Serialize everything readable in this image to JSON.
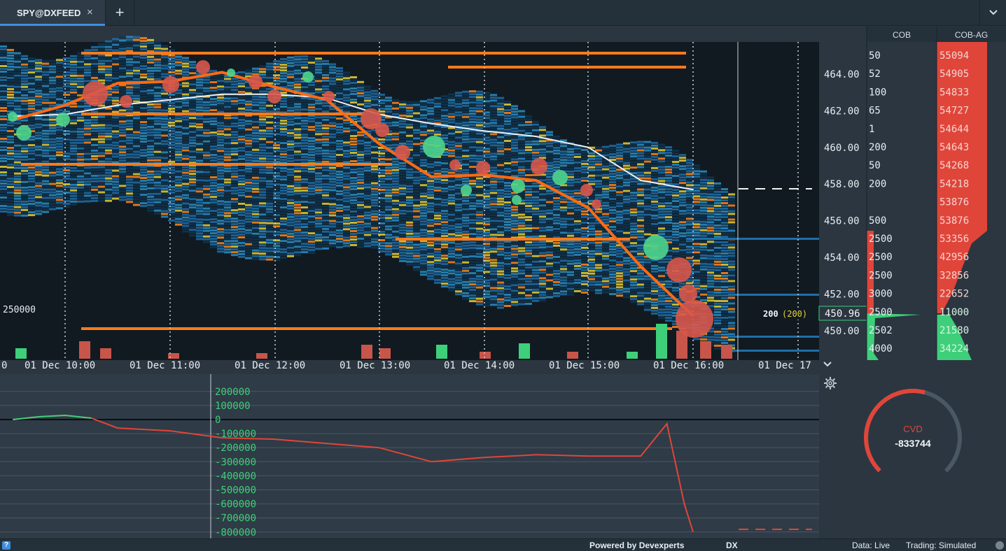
{
  "tab": {
    "title": "SPY@DXFEED",
    "close": "×",
    "add": "+",
    "menu": "⌄"
  },
  "price_axis": {
    "labels": [
      "464.00",
      "462.00",
      "460.00",
      "458.00",
      "456.00",
      "454.00",
      "452.00",
      "450.00"
    ],
    "current": "450.96"
  },
  "time_axis": {
    "labels": [
      "0",
      "01 Dec 10:00",
      "01 Dec 11:00",
      "01 Dec 12:00",
      "01 Dec 13:00",
      "01 Dec 14:00",
      "01 Dec 15:00",
      "01 Dec 16:00",
      "01 Dec 17"
    ]
  },
  "volume_scale_label": "250000",
  "order_label": {
    "size": "200",
    "paren": "(200)"
  },
  "cob": {
    "header": "COB",
    "values": [
      "50",
      "52",
      "100",
      "65",
      "1",
      "200",
      "50",
      "200",
      "",
      "500",
      "2500",
      "2500",
      "2500",
      "3000",
      "2500",
      "2502",
      "4000"
    ]
  },
  "cob_ag": {
    "header": "COB-AG",
    "values": [
      "55094",
      "54905",
      "54833",
      "54727",
      "54644",
      "54643",
      "54268",
      "54218",
      "53876",
      "53876",
      "53356",
      "42956",
      "32856",
      "22652",
      "11000",
      "21580",
      "34224"
    ]
  },
  "cvd_axis": {
    "labels": [
      "200000",
      "100000",
      "0",
      "-100000",
      "-200000",
      "-300000",
      "-400000",
      "-500000",
      "-600000",
      "-700000",
      "-800000"
    ]
  },
  "cvd": {
    "label": "CVD",
    "value": "-833744"
  },
  "status": {
    "powered": "Powered by Devexperts",
    "dx": "DX",
    "data": "Data: Live",
    "trading": "Trading: Simulated",
    "help": "?"
  },
  "colors": {
    "background": "#1a232b",
    "ask": "#e0453a",
    "bid": "#3ecf7a",
    "level": "#ff7a1a",
    "accent": "#3d8fe0"
  },
  "chart_data": [
    {
      "type": "line",
      "title": "",
      "ylabel": "",
      "ylim": [
        449,
        465
      ],
      "x": [
        "09:30",
        "10:00",
        "10:30",
        "11:00",
        "11:30",
        "12:00",
        "12:30",
        "13:00",
        "13:30",
        "14:00",
        "14:30",
        "15:00",
        "15:30",
        "16:00"
      ],
      "series": [
        {
          "values": [
            461.7,
            461.8,
            462.3,
            462.6,
            462.9,
            462.9,
            462.7,
            461.8,
            461.3,
            460.9,
            460.6,
            460.0,
            458.2,
            457.7
          ]
        },
        {
          "values": [
            461.5,
            462.3,
            463.5,
            463.6,
            464.1,
            463.3,
            462.6,
            460.2,
            458.4,
            458.5,
            458.2,
            456.7,
            453.5,
            450.8
          ]
        }
      ]
    },
    {
      "type": "line",
      "title": "",
      "ylabel": "",
      "ylim": [
        -850000,
        250000
      ],
      "x": [
        "09:30",
        "09:45",
        "10:00",
        "10:15",
        "10:30",
        "11:00",
        "11:30",
        "12:00",
        "12:30",
        "13:00",
        "13:30",
        "14:00",
        "14:30",
        "15:00",
        "15:30",
        "15:45",
        "15:55",
        "16:00"
      ],
      "series": [
        {
          "values": [
            0,
            20000,
            30000,
            10000,
            -60000,
            -80000,
            -130000,
            -140000,
            -170000,
            -200000,
            -300000,
            -270000,
            -250000,
            -260000,
            -260000,
            -30000,
            -600000,
            -800000
          ]
        }
      ]
    }
  ]
}
